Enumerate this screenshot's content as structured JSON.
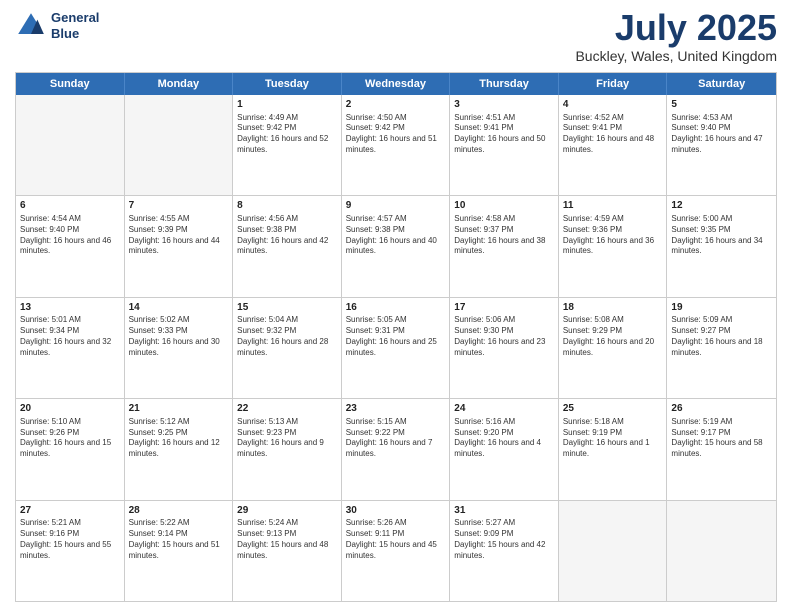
{
  "header": {
    "logo_line1": "General",
    "logo_line2": "Blue",
    "month": "July 2025",
    "location": "Buckley, Wales, United Kingdom"
  },
  "days_of_week": [
    "Sunday",
    "Monday",
    "Tuesday",
    "Wednesday",
    "Thursday",
    "Friday",
    "Saturday"
  ],
  "weeks": [
    [
      {
        "day": "",
        "empty": true
      },
      {
        "day": "",
        "empty": true
      },
      {
        "day": "1",
        "sunrise": "4:49 AM",
        "sunset": "9:42 PM",
        "daylight": "16 hours and 52 minutes."
      },
      {
        "day": "2",
        "sunrise": "4:50 AM",
        "sunset": "9:42 PM",
        "daylight": "16 hours and 51 minutes."
      },
      {
        "day": "3",
        "sunrise": "4:51 AM",
        "sunset": "9:41 PM",
        "daylight": "16 hours and 50 minutes."
      },
      {
        "day": "4",
        "sunrise": "4:52 AM",
        "sunset": "9:41 PM",
        "daylight": "16 hours and 48 minutes."
      },
      {
        "day": "5",
        "sunrise": "4:53 AM",
        "sunset": "9:40 PM",
        "daylight": "16 hours and 47 minutes."
      }
    ],
    [
      {
        "day": "6",
        "sunrise": "4:54 AM",
        "sunset": "9:40 PM",
        "daylight": "16 hours and 46 minutes."
      },
      {
        "day": "7",
        "sunrise": "4:55 AM",
        "sunset": "9:39 PM",
        "daylight": "16 hours and 44 minutes."
      },
      {
        "day": "8",
        "sunrise": "4:56 AM",
        "sunset": "9:38 PM",
        "daylight": "16 hours and 42 minutes."
      },
      {
        "day": "9",
        "sunrise": "4:57 AM",
        "sunset": "9:38 PM",
        "daylight": "16 hours and 40 minutes."
      },
      {
        "day": "10",
        "sunrise": "4:58 AM",
        "sunset": "9:37 PM",
        "daylight": "16 hours and 38 minutes."
      },
      {
        "day": "11",
        "sunrise": "4:59 AM",
        "sunset": "9:36 PM",
        "daylight": "16 hours and 36 minutes."
      },
      {
        "day": "12",
        "sunrise": "5:00 AM",
        "sunset": "9:35 PM",
        "daylight": "16 hours and 34 minutes."
      }
    ],
    [
      {
        "day": "13",
        "sunrise": "5:01 AM",
        "sunset": "9:34 PM",
        "daylight": "16 hours and 32 minutes."
      },
      {
        "day": "14",
        "sunrise": "5:02 AM",
        "sunset": "9:33 PM",
        "daylight": "16 hours and 30 minutes."
      },
      {
        "day": "15",
        "sunrise": "5:04 AM",
        "sunset": "9:32 PM",
        "daylight": "16 hours and 28 minutes."
      },
      {
        "day": "16",
        "sunrise": "5:05 AM",
        "sunset": "9:31 PM",
        "daylight": "16 hours and 25 minutes."
      },
      {
        "day": "17",
        "sunrise": "5:06 AM",
        "sunset": "9:30 PM",
        "daylight": "16 hours and 23 minutes."
      },
      {
        "day": "18",
        "sunrise": "5:08 AM",
        "sunset": "9:29 PM",
        "daylight": "16 hours and 20 minutes."
      },
      {
        "day": "19",
        "sunrise": "5:09 AM",
        "sunset": "9:27 PM",
        "daylight": "16 hours and 18 minutes."
      }
    ],
    [
      {
        "day": "20",
        "sunrise": "5:10 AM",
        "sunset": "9:26 PM",
        "daylight": "16 hours and 15 minutes."
      },
      {
        "day": "21",
        "sunrise": "5:12 AM",
        "sunset": "9:25 PM",
        "daylight": "16 hours and 12 minutes."
      },
      {
        "day": "22",
        "sunrise": "5:13 AM",
        "sunset": "9:23 PM",
        "daylight": "16 hours and 9 minutes."
      },
      {
        "day": "23",
        "sunrise": "5:15 AM",
        "sunset": "9:22 PM",
        "daylight": "16 hours and 7 minutes."
      },
      {
        "day": "24",
        "sunrise": "5:16 AM",
        "sunset": "9:20 PM",
        "daylight": "16 hours and 4 minutes."
      },
      {
        "day": "25",
        "sunrise": "5:18 AM",
        "sunset": "9:19 PM",
        "daylight": "16 hours and 1 minute."
      },
      {
        "day": "26",
        "sunrise": "5:19 AM",
        "sunset": "9:17 PM",
        "daylight": "15 hours and 58 minutes."
      }
    ],
    [
      {
        "day": "27",
        "sunrise": "5:21 AM",
        "sunset": "9:16 PM",
        "daylight": "15 hours and 55 minutes."
      },
      {
        "day": "28",
        "sunrise": "5:22 AM",
        "sunset": "9:14 PM",
        "daylight": "15 hours and 51 minutes."
      },
      {
        "day": "29",
        "sunrise": "5:24 AM",
        "sunset": "9:13 PM",
        "daylight": "15 hours and 48 minutes."
      },
      {
        "day": "30",
        "sunrise": "5:26 AM",
        "sunset": "9:11 PM",
        "daylight": "15 hours and 45 minutes."
      },
      {
        "day": "31",
        "sunrise": "5:27 AM",
        "sunset": "9:09 PM",
        "daylight": "15 hours and 42 minutes."
      },
      {
        "day": "",
        "empty": true
      },
      {
        "day": "",
        "empty": true
      }
    ]
  ]
}
